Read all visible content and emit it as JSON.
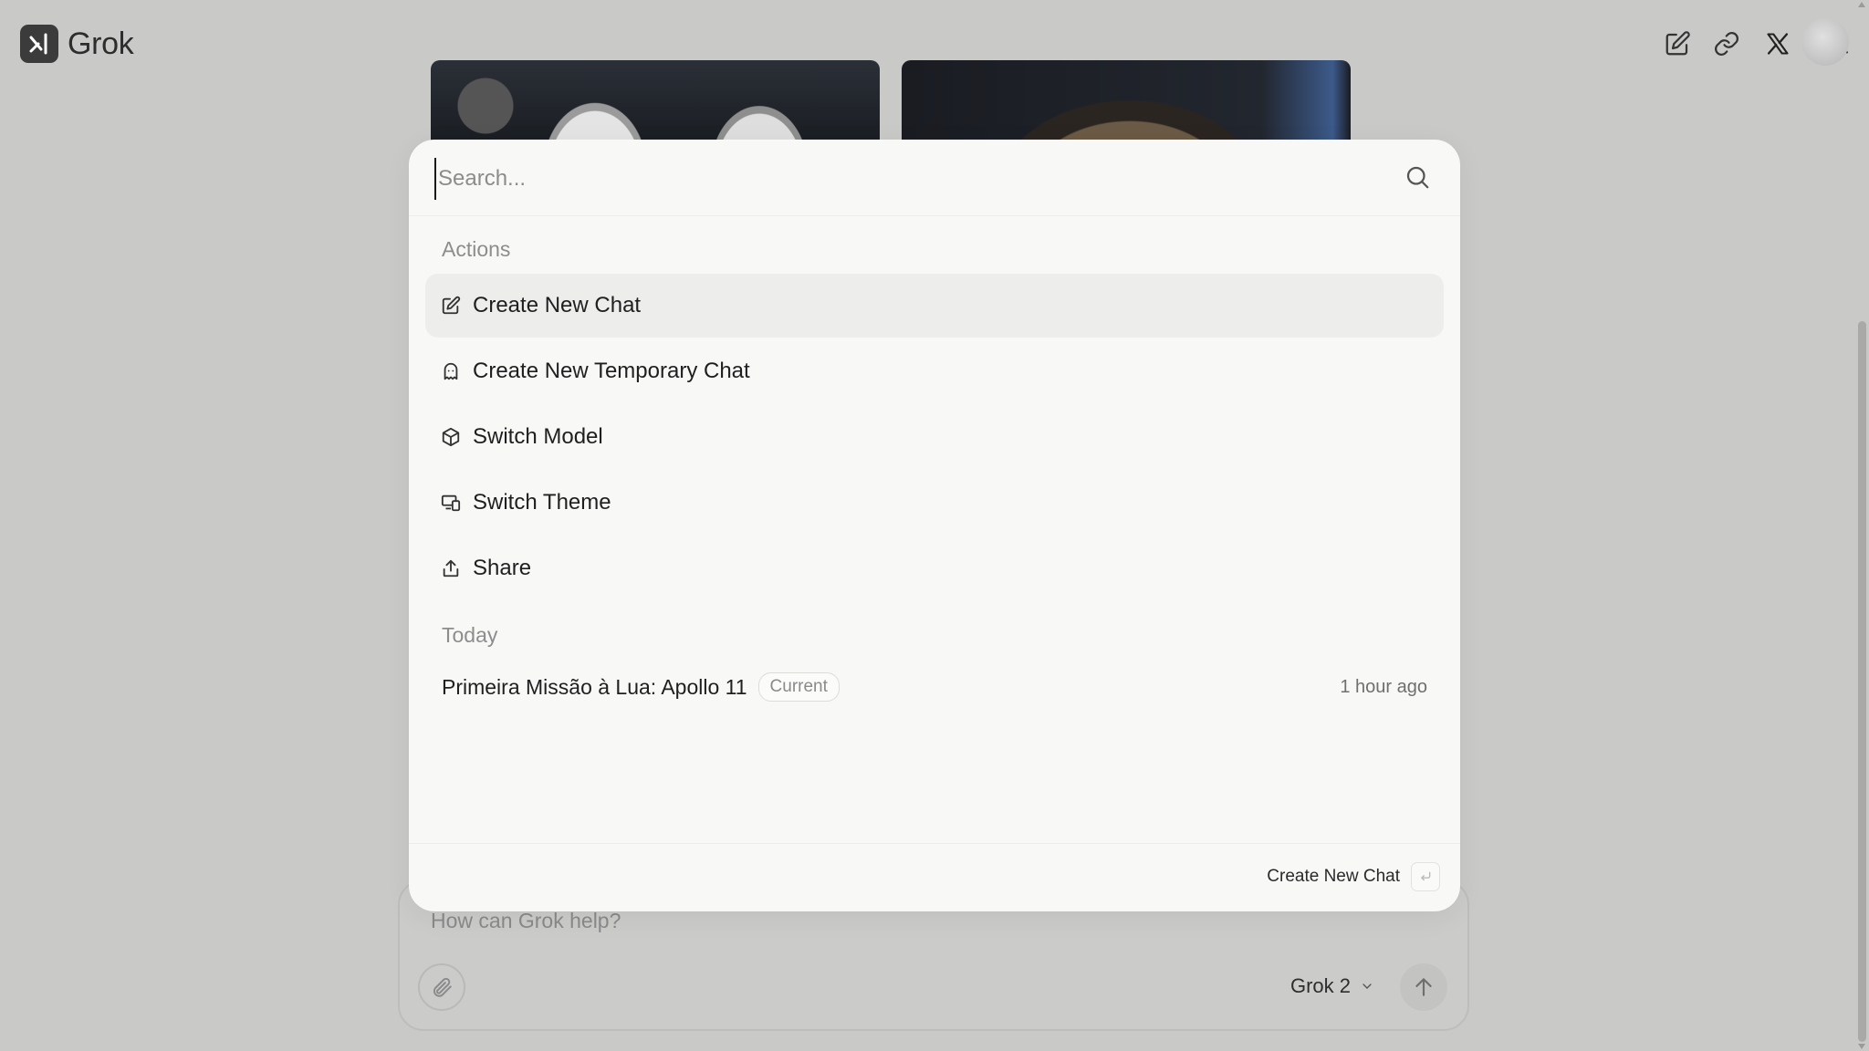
{
  "app": {
    "name": "Grok"
  },
  "topbar": {
    "icons": [
      "edit-icon",
      "link-icon",
      "x-logo-icon",
      "search-history-icon"
    ],
    "avatar": "avatar"
  },
  "palette": {
    "search": {
      "value": "",
      "placeholder": "Search..."
    },
    "sections": {
      "actions_label": "Actions",
      "today_label": "Today"
    },
    "actions": [
      {
        "label": "Create New Chat",
        "icon": "edit-icon",
        "active": true
      },
      {
        "label": "Create New Temporary Chat",
        "icon": "ghost-icon",
        "active": false
      },
      {
        "label": "Switch Model",
        "icon": "cube-icon",
        "active": false
      },
      {
        "label": "Switch Theme",
        "icon": "theme-icon",
        "active": false
      },
      {
        "label": "Share",
        "icon": "share-icon",
        "active": false
      }
    ],
    "history": [
      {
        "title": "Primeira Missão à Lua: Apollo 11",
        "badge": "Current",
        "time": "1 hour ago"
      }
    ],
    "footer": {
      "action_label": "Create New Chat",
      "key_hint": "⏎"
    }
  },
  "composer": {
    "placeholder": "How can Grok help?",
    "model": "Grok 2"
  },
  "colors": {
    "background": "#c9c9c8",
    "palette_bg": "#f8f8f7",
    "active_item": "#ededec",
    "muted_text": "#8d8d8d"
  }
}
